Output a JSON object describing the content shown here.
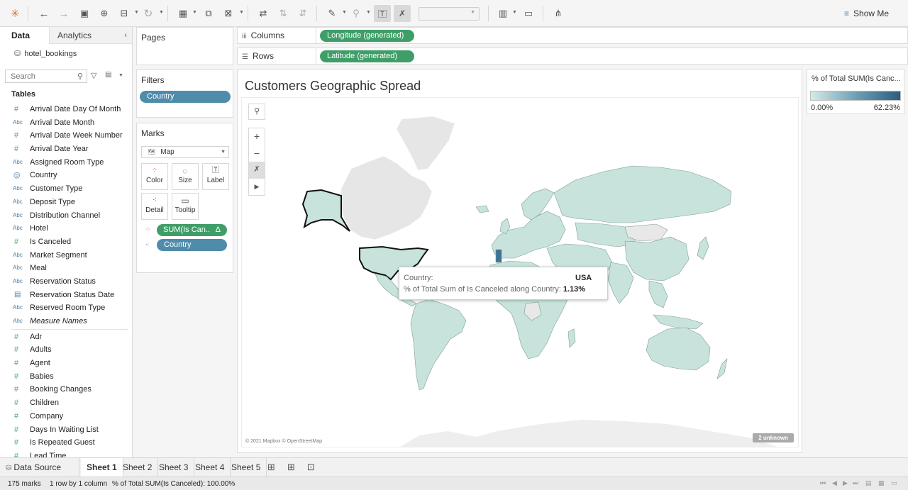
{
  "toolbar": {
    "show_me_label": "Show Me",
    "dropdown_value": ""
  },
  "data_pane": {
    "tab_data": "Data",
    "tab_analytics": "Analytics",
    "datasource": "hotel_bookings",
    "search_placeholder": "Search",
    "tables_header": "Tables",
    "fields": [
      {
        "icon": "#",
        "type": "num",
        "label": "Arrival Date Day Of Month"
      },
      {
        "icon": "Abc",
        "type": "str",
        "label": "Arrival Date Month"
      },
      {
        "icon": "#",
        "type": "num",
        "label": "Arrival Date Week Number"
      },
      {
        "icon": "#",
        "type": "num",
        "label": "Arrival Date Year"
      },
      {
        "icon": "Abc",
        "type": "str",
        "label": "Assigned Room Type"
      },
      {
        "icon": "◎",
        "type": "geo",
        "label": "Country"
      },
      {
        "icon": "Abc",
        "type": "str",
        "label": "Customer Type"
      },
      {
        "icon": "Abc",
        "type": "str",
        "label": "Deposit Type"
      },
      {
        "icon": "Abc",
        "type": "str",
        "label": "Distribution Channel"
      },
      {
        "icon": "Abc",
        "type": "str",
        "label": "Hotel"
      },
      {
        "icon": "#",
        "type": "num",
        "label": "Is Canceled"
      },
      {
        "icon": "Abc",
        "type": "str",
        "label": "Market Segment"
      },
      {
        "icon": "Abc",
        "type": "str",
        "label": "Meal"
      },
      {
        "icon": "Abc",
        "type": "str",
        "label": "Reservation Status"
      },
      {
        "icon": "▤",
        "type": "date",
        "label": "Reservation Status Date"
      },
      {
        "icon": "Abc",
        "type": "str",
        "label": "Reserved Room Type"
      },
      {
        "icon": "Abc",
        "type": "str",
        "label": "Measure Names",
        "italic": true
      }
    ],
    "measures": [
      {
        "icon": "#",
        "label": "Adr"
      },
      {
        "icon": "#",
        "label": "Adults"
      },
      {
        "icon": "#",
        "label": "Agent"
      },
      {
        "icon": "#",
        "label": "Babies"
      },
      {
        "icon": "#",
        "label": "Booking Changes"
      },
      {
        "icon": "#",
        "label": "Children"
      },
      {
        "icon": "#",
        "label": "Company"
      },
      {
        "icon": "#",
        "label": "Days In Waiting List"
      },
      {
        "icon": "#",
        "label": "Is Repeated Guest"
      },
      {
        "icon": "#",
        "label": "Lead Time"
      }
    ]
  },
  "pages": {
    "title": "Pages"
  },
  "filters": {
    "title": "Filters",
    "pill": "Country"
  },
  "marks": {
    "title": "Marks",
    "mark_type": "Map",
    "buttons": {
      "color": "Color",
      "size": "Size",
      "label": "Label",
      "detail": "Detail",
      "tooltip": "Tooltip"
    },
    "pill_measure": "SUM(Is Can..",
    "pill_measure_delta": "Δ",
    "pill_dimension": "Country"
  },
  "shelves": {
    "columns_label": "Columns",
    "columns_pill": "Longitude (generated)",
    "rows_label": "Rows",
    "rows_pill": "Latitude (generated)"
  },
  "view": {
    "title": "Customers Geographic Spread",
    "attribution": "© 2021 Mapbox © OpenStreetMap",
    "unknown_badge": "2 unknown",
    "tooltip": {
      "label1": "Country:",
      "value1": "USA",
      "label2": "% of Total Sum of Is Canceled along Country:",
      "value2": "1.13%"
    }
  },
  "legend": {
    "title": "% of Total SUM(Is Canc...",
    "min": "0.00%",
    "max": "62.23%",
    "colors": [
      "#d5ebe5",
      "#6ea0b7",
      "#2c5c80"
    ]
  },
  "sheet_tabs": {
    "datasource": "Data Source",
    "sheets": [
      "Sheet 1",
      "Sheet 2",
      "Sheet 3",
      "Sheet 4",
      "Sheet 5"
    ],
    "active": "Sheet 1"
  },
  "status": {
    "marks": "175 marks",
    "dims": "1 row by 1 column",
    "sum": "% of Total SUM(Is Canceled): 100.00%"
  },
  "colors": {
    "map_fill": "#c8e3dc",
    "map_stroke": "#7f9c98",
    "land_gray": "#e8e8e8",
    "pill_blue": "#4f8cab",
    "pill_green": "#3f9e68"
  }
}
